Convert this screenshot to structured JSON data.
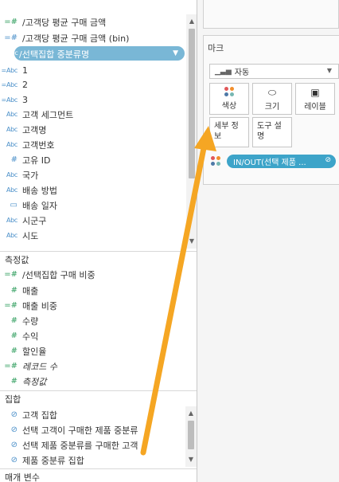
{
  "left_pane": {
    "dimensions": [
      {
        "icon": "=#",
        "label": "/고객당 평균 구매 금액",
        "italic": false
      },
      {
        "icon": "=#",
        "label": "/고객당 평균 구매 금액 (bin)",
        "italic": false
      },
      {
        "icon": "=Abc",
        "label": "/선택집합 중분류명",
        "italic": false,
        "selected": true
      },
      {
        "icon": "=Abc",
        "label": "1",
        "italic": false
      },
      {
        "icon": "=Abc",
        "label": "2",
        "italic": false
      },
      {
        "icon": "=Abc",
        "label": "3",
        "italic": false
      },
      {
        "icon": "Abc",
        "label": "고객 세그먼트",
        "italic": false
      },
      {
        "icon": "Abc",
        "label": "고객명",
        "italic": false
      },
      {
        "icon": "Abc",
        "label": "고객번호",
        "italic": false
      },
      {
        "icon": "#",
        "label": "고유 ID",
        "italic": false
      },
      {
        "icon": "Abc",
        "label": "국가",
        "italic": false
      },
      {
        "icon": "Abc",
        "label": "배송 방법",
        "italic": false
      },
      {
        "icon": "calendar",
        "label": "배송 일자",
        "italic": false
      },
      {
        "icon": "Abc",
        "label": "시군구",
        "italic": false
      },
      {
        "icon": "Abc",
        "label": "시도",
        "italic": false
      }
    ],
    "measures_title": "측정값",
    "measures": [
      {
        "icon": "=#",
        "label": "/선택집합 구매 비중",
        "italic": false
      },
      {
        "icon": "#",
        "label": "매출",
        "italic": false
      },
      {
        "icon": "=#",
        "label": "매출 비중",
        "italic": false
      },
      {
        "icon": "#",
        "label": "수량",
        "italic": false
      },
      {
        "icon": "#",
        "label": "수익",
        "italic": false
      },
      {
        "icon": "#",
        "label": "할인율",
        "italic": false
      },
      {
        "icon": "=#",
        "label": "레코드 수",
        "italic": true
      },
      {
        "icon": "#",
        "label": "측정값",
        "italic": true
      }
    ],
    "sets_title": "집합",
    "sets": [
      {
        "label": "고객 집합"
      },
      {
        "label": "선택 고객이 구매한 제품 중분류"
      },
      {
        "label": "선택 제품 중분류를 구매한 고객"
      },
      {
        "label": "제품 중분류 집합"
      }
    ],
    "parameters_title": "매개 변수"
  },
  "marks": {
    "title": "마크",
    "mark_type": "자동",
    "cards": {
      "color": "색상",
      "size": "크기",
      "label": "레이블",
      "detail": "세부 정보",
      "tooltip": "도구 설명"
    },
    "color_pill": "IN/OUT(선택 제품 ..."
  },
  "colors": {
    "accent_arrow": "#f5a623",
    "pill_blue": "#79b7d6",
    "mark_pill_blue": "#3da4c9",
    "field_blue": "#4a8fc9",
    "measure_green": "#2c9c5b"
  }
}
